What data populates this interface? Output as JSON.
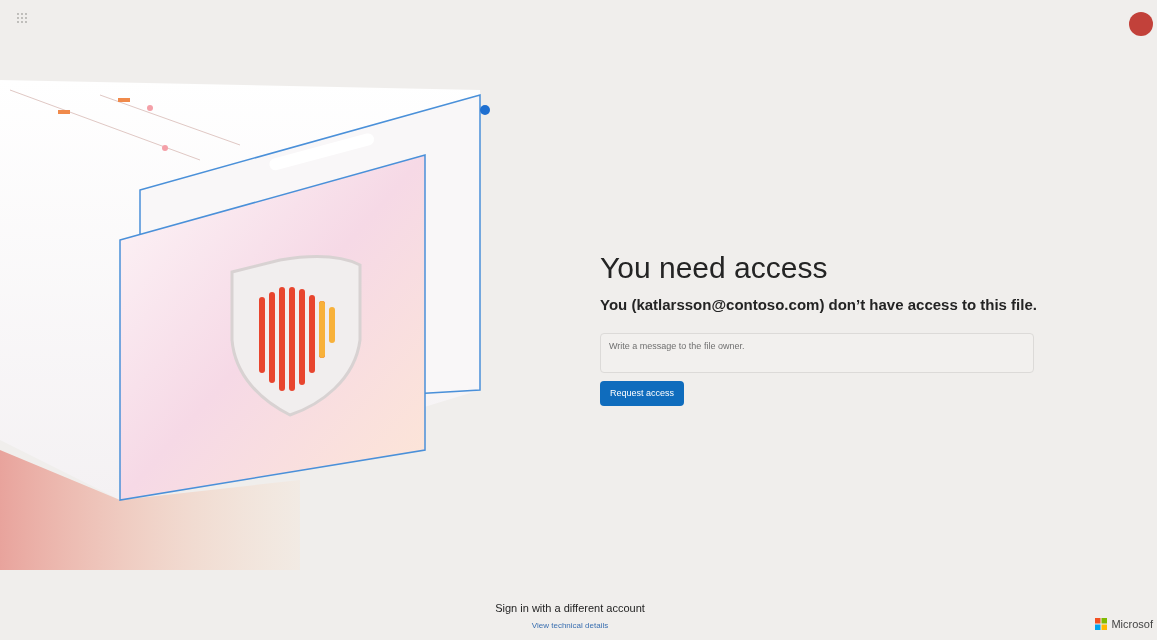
{
  "heading": "You need access",
  "message": "You (katlarsson@contoso.com) don’t have access to this file.",
  "message_field": {
    "placeholder": "Write a message to the file owner."
  },
  "request_button": "Request access",
  "footer": {
    "switch_account": "Sign in with a different account",
    "technical_details": "View technical details",
    "brand": "Microsof"
  }
}
